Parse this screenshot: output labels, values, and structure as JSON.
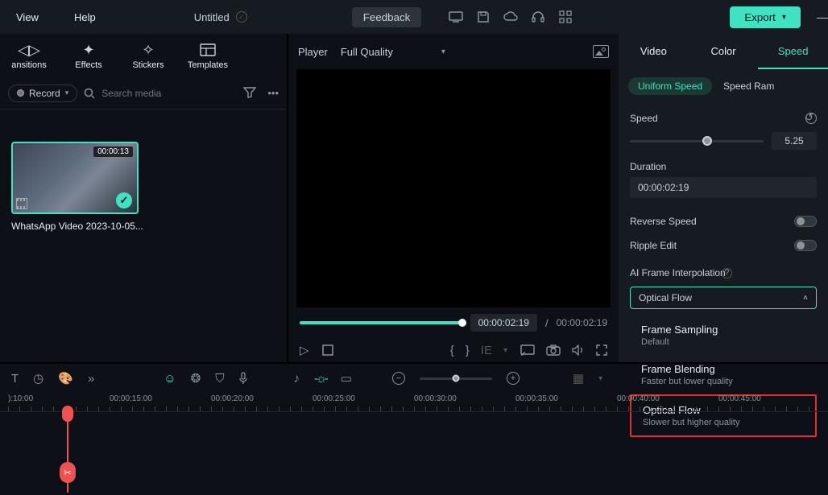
{
  "menu": {
    "view": "View",
    "help": "Help"
  },
  "doc_title": "Untitled",
  "feedback_label": "Feedback",
  "export_label": "Export",
  "left": {
    "tabs": {
      "transitions": "ansitions",
      "effects": "Effects",
      "stickers": "Stickers",
      "templates": "Templates"
    },
    "record_label": "Record",
    "search_placeholder": "Search media",
    "clip": {
      "duration": "00:00:13",
      "name": "WhatsApp Video 2023-10-05..."
    }
  },
  "player": {
    "tab_label": "Player",
    "quality": "Full Quality",
    "current_time": "00:00:02:19",
    "total_time": "00:00:02:19"
  },
  "right": {
    "tabs": {
      "video": "Video",
      "color": "Color",
      "speed": "Speed"
    },
    "subtabs": {
      "uniform": "Uniform Speed",
      "ramp": "Speed Ram"
    },
    "speed_label": "Speed",
    "speed_value": "5.25",
    "duration_label": "Duration",
    "duration_value": "00:00:02:19",
    "reverse_label": "Reverse Speed",
    "ripple_label": "Ripple Edit",
    "aiframe_label": "AI Frame Interpolation",
    "dd_value": "Optical Flow",
    "options": [
      {
        "title": "Frame Sampling",
        "sub": "Default"
      },
      {
        "title": "Frame Blending",
        "sub": "Faster but lower quality"
      },
      {
        "title": "Optical Flow",
        "sub": "Slower but higher quality"
      }
    ]
  },
  "timeline": {
    "stamps": [
      "):10:00",
      "00:00:15:00",
      "00:00:20:00",
      "00:00:25:00",
      "00:00:30:00",
      "00:00:35:00",
      "00:00:40:00",
      "00:00:45:00"
    ]
  }
}
